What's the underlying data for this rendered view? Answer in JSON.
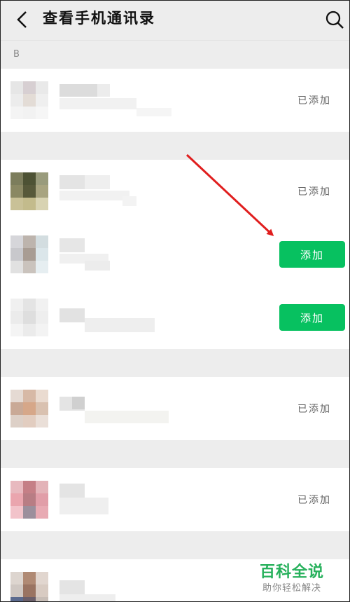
{
  "header": {
    "title": "查看手机通讯录",
    "back_icon": "chevron-left-icon",
    "search_icon": "search-icon"
  },
  "sections": [
    {
      "letter": "B"
    }
  ],
  "contacts": [
    {
      "status": "已添加",
      "state": "added"
    },
    {
      "status": "已添加",
      "state": "added"
    },
    {
      "status": "添加",
      "state": "add"
    },
    {
      "status": "添加",
      "state": "add"
    },
    {
      "status": "已添加",
      "state": "added"
    },
    {
      "status": "已添加",
      "state": "added"
    }
  ],
  "colors": {
    "add_button": "#07c160",
    "background": "#ededed",
    "arrow": "#e01e1e",
    "watermark": "#27b15c"
  },
  "watermark": {
    "title": "百科全说",
    "subtitle": "助你轻松解决"
  }
}
